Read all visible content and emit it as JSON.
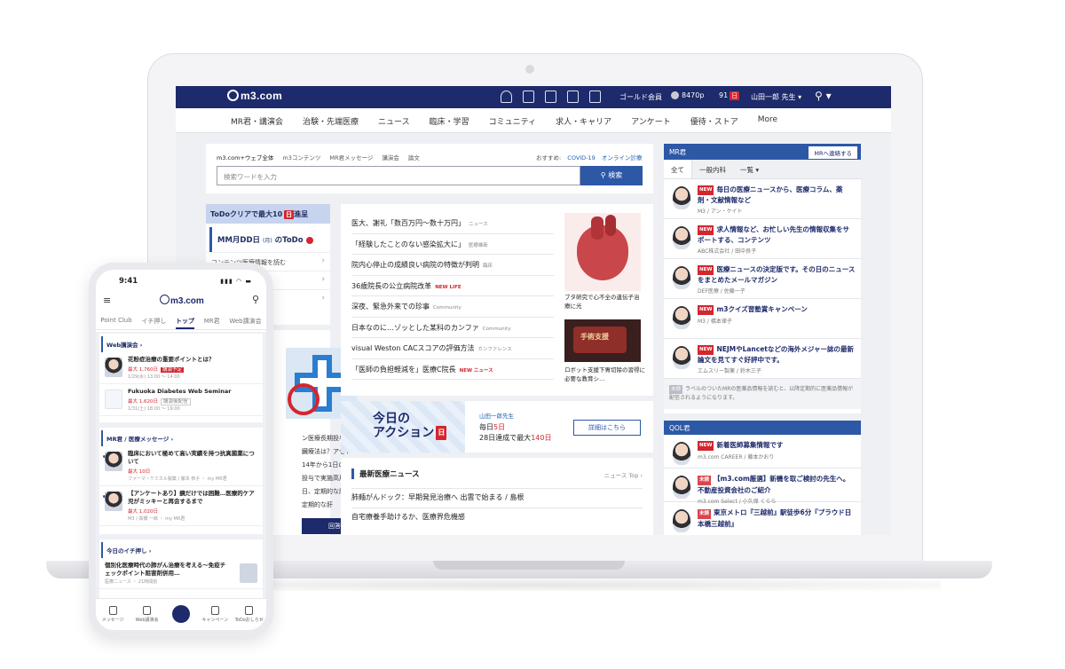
{
  "laptop": {
    "topbar": {
      "logo_text": "m3.com",
      "gold_label": "ゴールド会員",
      "points": "8470p",
      "notif_count": "91",
      "notif_badge": "日",
      "user": "山田一郎 先生 ▾",
      "search_icon_glyph": "⚲ ▾"
    },
    "nav": [
      "MR君・講演会",
      "治験・先端医療",
      "ニュース",
      "臨床・学習",
      "コミュニティ",
      "求人・キャリア",
      "アンケート",
      "優待・ストア",
      "More"
    ],
    "search": {
      "scopes": [
        "m3.com+ウェブ全体",
        "m3コンテンツ",
        "MR君メッセージ",
        "講演会",
        "論文"
      ],
      "recommend_label": "おすすめ:",
      "recommend_links": [
        "COVID-19",
        "オンライン診療"
      ],
      "placeholder": "検索ワードを入力",
      "button": "⚲ 検索"
    },
    "todo": {
      "header": "ToDoクリアで最大10",
      "header_badge": "日",
      "header_suffix": "進呈",
      "date_line": "MM月DD日",
      "date_sub": "(月)",
      "todo_label": "のToDo",
      "count": "3",
      "rows": [
        "コンテンツ医療情報を読む",
        "",
        ""
      ]
    },
    "left_card": {
      "text": "ン医療長期投与で肝臓療法は？アセト14年から1日の上の投与で実施高用量日、定期的な肝が、定期的な肝",
      "button": "回答する"
    },
    "news": [
      {
        "title": "医大、謝礼「数百万円～数十万円」",
        "tag": "ニュース",
        "new": false
      },
      {
        "title": "「経験したことのない感染拡大に」",
        "tag": "医療維新",
        "new": false
      },
      {
        "title": "院内心停止の成績良い病院の特徴が判明",
        "tag": "臨床",
        "new": false
      },
      {
        "title": "36歳院長の公立病院改革",
        "tag": "NEW LIFE",
        "new": true
      },
      {
        "title": "深夜、緊急外来での珍事",
        "tag": "Community",
        "new": false
      },
      {
        "title": "日本なのに…ゾッとした某科のカンファ",
        "tag": "Community",
        "new": false
      },
      {
        "title": "visual Weston CACスコアの評価方法",
        "tag": "カンファレンス",
        "new": false
      },
      {
        "title": "「医師の負担軽減を」医療C院長",
        "tag": "NEW ニュース",
        "new": true
      }
    ],
    "news_images": {
      "caption1": "ブタ研究で心不全の遺伝子治療に光",
      "caption2": "ロボット支援下胃切除の習得に必要な教育シ…",
      "robot_text": "手術支援"
    },
    "action": {
      "title_line1": "今日の",
      "title_line2": "アクション",
      "title_badge": "日",
      "user": "山田一郎先生",
      "day_prefix": "毎日",
      "day_value": "5日",
      "reward_prefix": "28日達成で最大",
      "reward_value": "140日",
      "button": "詳細はこちら"
    },
    "latest": {
      "header": "最新医療ニュース",
      "top_link": "ニュース Top ›",
      "items": [
        "肺麺がんドック：早期発見治療へ 出雲で始まる / 島根",
        "自宅療養手助けるか、医療界危機感"
      ]
    },
    "mr_panel": {
      "header": "MR君",
      "button": "MRへ連絡する",
      "tabs": [
        "全て",
        "一般内科",
        "一覧 ▾"
      ],
      "items": [
        {
          "new": "NEW",
          "title": "毎日の医療ニュースから、医療コラム、薬剤・文献情報など",
          "sub": "M3 / アン・ケイト"
        },
        {
          "new": "NEW",
          "title": "求人情報など、お忙しい先生の情報収集をサポートする、コンテンツ",
          "sub": "ABC株式会社 / 田中良子"
        },
        {
          "new": "NEW",
          "title": "医療ニュースの決定版です。その日のニュースをまとめたメールマガジン",
          "sub": "DEF医療 / 佐藤一子"
        },
        {
          "new": "NEW",
          "title": "m3クイズ習塾賞キャンペーン",
          "sub": "M3 / 橋本律子"
        },
        {
          "new": "NEW",
          "title": "NEJMやLancetなどの海外メジャー誌の最新論文を見てすぐ好評中です。",
          "sub": "エムスリー製薬 / 鈴木三子"
        }
      ],
      "foot_tag": "未読",
      "foot_text": "ラベルのついたMRの医薬品情報を読むと、以降定期的に医薬品情報が配信されるようになります。"
    },
    "qol": {
      "header": "QOL君",
      "items": [
        {
          "new": "NEW",
          "title": "新着医師募集情報です",
          "sub": "m3.com CAREER / 藤本かおり"
        },
        {
          "new": "未読",
          "title": "【m3.com厳選】新機を取ご検討の先生へ。不動産投資会社のご紹介",
          "sub": "m3.com Select / 小久保 くらら"
        },
        {
          "new": "未読",
          "title": "東京メトロ『三越前』駅徒歩6分『プラウド日本橋三越前』",
          "sub": ""
        }
      ]
    }
  },
  "phone": {
    "time": "9:41",
    "signal": "▮▮▮ ◠ ▬",
    "menu_glyph": "≡",
    "logo": "m3.com",
    "search_glyph": "⚲",
    "tabs": [
      "Point Club",
      "イチ押し",
      "トップ",
      "MR君",
      "Web講演会"
    ],
    "web_section": "Web講演会 ›",
    "web_cards": [
      {
        "title": "花粉症治療の重要ポイントとは？",
        "reward": "最大 1,760日",
        "tag": "講演予定",
        "date": "1/29(水) 13:00 〜 14:00"
      },
      {
        "title": "Fukuoka Diabetes Web Seminar",
        "reward": "最大 1,620日",
        "tag": "講演後配信",
        "date": "1/31(土) 18:00 〜 19:00"
      }
    ],
    "mr_section": "MR君 / 医療メッセージ ›",
    "mr_cards": [
      {
        "title": "臨床において極めて高い実績を持つ抗真菌薬について",
        "reward": "最大 10日",
        "date": "ファーマ・ケミカル製薬 / 藤本 恭子 ・ my MR君"
      },
      {
        "title": "【アンケートあり】鏡だけでは困難…医療的ケア児がミッキーと再会するまで",
        "reward": "最大 1,020日",
        "date": "M3 / 高橋 一郎 ・ my MR君"
      }
    ],
    "pick_section": "今日のイチ押し ›",
    "pick_title": "個別化医療時代の肺がん治療を考える〜免疫チェックポイント阻害剤併用…",
    "pick_sub": "医療ニュース ・ 21時間前",
    "bottom": [
      "メッセージ",
      "Web講演会",
      "",
      "キャンペーン",
      "ToDoおしらせ"
    ]
  }
}
